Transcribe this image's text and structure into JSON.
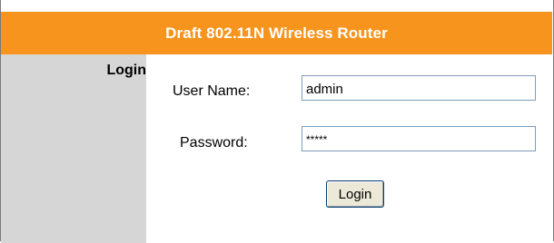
{
  "header": {
    "title": "Draft 802.11N Wireless Router"
  },
  "sidebar": {
    "title": "Login"
  },
  "form": {
    "username_label": "User Name:",
    "username_value": "admin",
    "password_label": "Password:",
    "password_value": "*****",
    "login_button": "Login"
  },
  "colors": {
    "header_bg": "#f7941d",
    "sidebar_bg": "#d6d6d6"
  }
}
